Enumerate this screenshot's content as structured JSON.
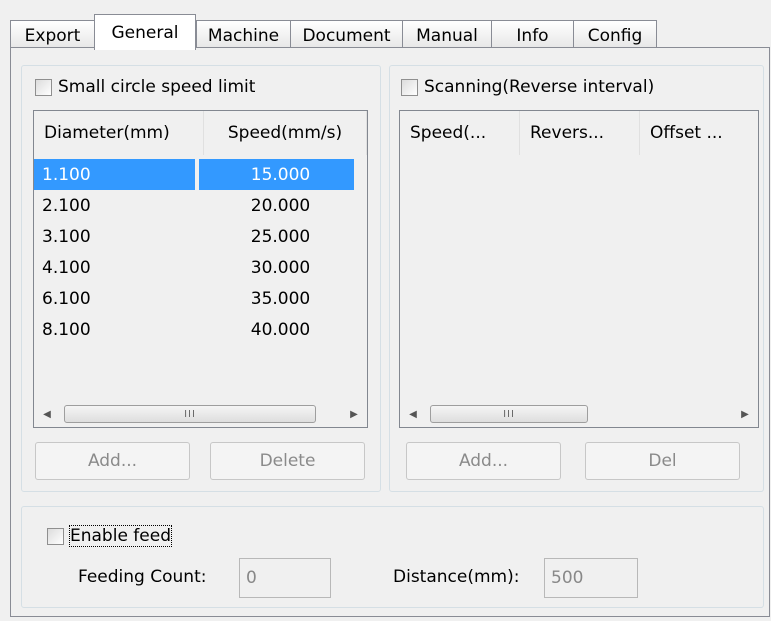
{
  "tabs": [
    {
      "label": "Export"
    },
    {
      "label": "General"
    },
    {
      "label": "Machine"
    },
    {
      "label": "Document"
    },
    {
      "label": "Manual"
    },
    {
      "label": "Info"
    },
    {
      "label": "Config"
    }
  ],
  "active_tab": "General",
  "small_circle": {
    "checkbox_label": "Small circle speed limit",
    "checked": false,
    "columns": [
      "Diameter(mm)",
      "Speed(mm/s)"
    ],
    "rows": [
      [
        "1.100",
        "15.000"
      ],
      [
        "2.100",
        "20.000"
      ],
      [
        "3.100",
        "25.000"
      ],
      [
        "4.100",
        "30.000"
      ],
      [
        "6.100",
        "35.000"
      ],
      [
        "8.100",
        "40.000"
      ]
    ],
    "selected_row": 0,
    "add_label": "Add...",
    "delete_label": "Delete"
  },
  "scanning": {
    "checkbox_label": "Scanning(Reverse interval)",
    "checked": false,
    "columns": [
      "Speed(...",
      "Revers...",
      "Offset ..."
    ],
    "add_label": "Add...",
    "del_label": "Del"
  },
  "feed": {
    "checkbox_label": "Enable feed",
    "checked": false,
    "count_label": "Feeding Count:",
    "count_value": "0",
    "distance_label": "Distance(mm):",
    "distance_value": "500"
  },
  "scrollbar": {
    "thumb_grip": "III"
  }
}
